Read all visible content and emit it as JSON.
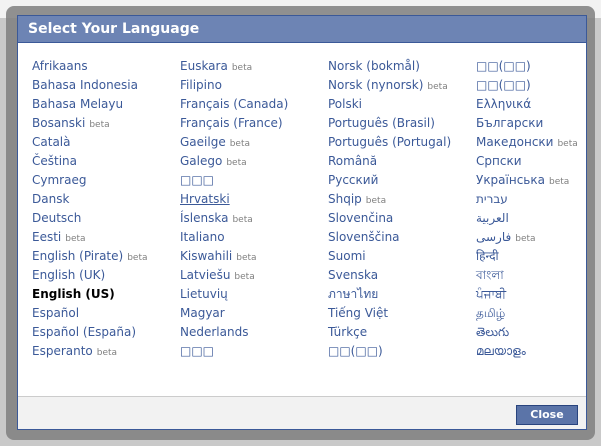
{
  "dialog": {
    "title": "Select Your Language",
    "close_label": "Close"
  },
  "beta_label": "beta",
  "columns": [
    [
      {
        "label": "Afrikaans",
        "beta": false
      },
      {
        "label": "Bahasa Indonesia",
        "beta": false
      },
      {
        "label": "Bahasa Melayu",
        "beta": false
      },
      {
        "label": "Bosanski",
        "beta": true
      },
      {
        "label": "Català",
        "beta": false
      },
      {
        "label": "Čeština",
        "beta": false
      },
      {
        "label": "Cymraeg",
        "beta": false
      },
      {
        "label": "Dansk",
        "beta": false
      },
      {
        "label": "Deutsch",
        "beta": false
      },
      {
        "label": "Eesti",
        "beta": true
      },
      {
        "label": "English (Pirate)",
        "beta": true
      },
      {
        "label": "English (UK)",
        "beta": false
      },
      {
        "label": "English (US)",
        "beta": false,
        "selected": true
      },
      {
        "label": "Español",
        "beta": false
      },
      {
        "label": "Español (España)",
        "beta": false
      },
      {
        "label": "Esperanto",
        "beta": true
      }
    ],
    [
      {
        "label": "Euskara",
        "beta": true
      },
      {
        "label": "Filipino",
        "beta": false
      },
      {
        "label": "Français (Canada)",
        "beta": false
      },
      {
        "label": "Français (France)",
        "beta": false
      },
      {
        "label": "Gaeilge",
        "beta": true
      },
      {
        "label": "Galego",
        "beta": true
      },
      {
        "label": "□□□",
        "beta": false
      },
      {
        "label": "Hrvatski",
        "beta": false,
        "underline": true
      },
      {
        "label": "Íslenska",
        "beta": true
      },
      {
        "label": "Italiano",
        "beta": false
      },
      {
        "label": "Kiswahili",
        "beta": true
      },
      {
        "label": "Latviešu",
        "beta": true
      },
      {
        "label": "Lietuvių",
        "beta": false
      },
      {
        "label": "Magyar",
        "beta": false
      },
      {
        "label": "Nederlands",
        "beta": false
      },
      {
        "label": "□□□",
        "beta": false
      }
    ],
    [
      {
        "label": "Norsk (bokmål)",
        "beta": false
      },
      {
        "label": "Norsk (nynorsk)",
        "beta": true
      },
      {
        "label": "Polski",
        "beta": false
      },
      {
        "label": "Português (Brasil)",
        "beta": false
      },
      {
        "label": "Português (Portugal)",
        "beta": false
      },
      {
        "label": "Română",
        "beta": false
      },
      {
        "label": "Русский",
        "beta": false
      },
      {
        "label": "Shqip",
        "beta": true
      },
      {
        "label": "Slovenčina",
        "beta": false
      },
      {
        "label": "Slovenščina",
        "beta": false
      },
      {
        "label": "Suomi",
        "beta": false
      },
      {
        "label": "Svenska",
        "beta": false
      },
      {
        "label": "ภาษาไทย",
        "beta": false
      },
      {
        "label": "Tiếng Việt",
        "beta": false
      },
      {
        "label": "Türkçe",
        "beta": false
      },
      {
        "label": "□□(□□)",
        "beta": false
      }
    ],
    [
      {
        "label": "□□(□□)",
        "beta": false
      },
      {
        "label": "□□(□□)",
        "beta": false
      },
      {
        "label": "Ελληνικά",
        "beta": false
      },
      {
        "label": "Български",
        "beta": false
      },
      {
        "label": "Македонски",
        "beta": true
      },
      {
        "label": "Српски",
        "beta": false
      },
      {
        "label": "Українська",
        "beta": true
      },
      {
        "label": "עברית",
        "beta": false
      },
      {
        "label": "العربية",
        "beta": false
      },
      {
        "label": "فارسی",
        "beta": true
      },
      {
        "label": "हिन्दी",
        "beta": false
      },
      {
        "label": "বাংলা",
        "beta": false
      },
      {
        "label": "ਪੰਜਾਬੀ",
        "beta": false
      },
      {
        "label": "தமிழ்",
        "beta": false
      },
      {
        "label": "తెలుగు",
        "beta": false
      },
      {
        "label": "മലയാളം",
        "beta": false
      }
    ]
  ],
  "colors": {
    "header_bg": "#6d84b4",
    "border": "#3b5998",
    "link": "#3b5998",
    "beta": "#808080",
    "button_bg": "#5b74a8"
  }
}
